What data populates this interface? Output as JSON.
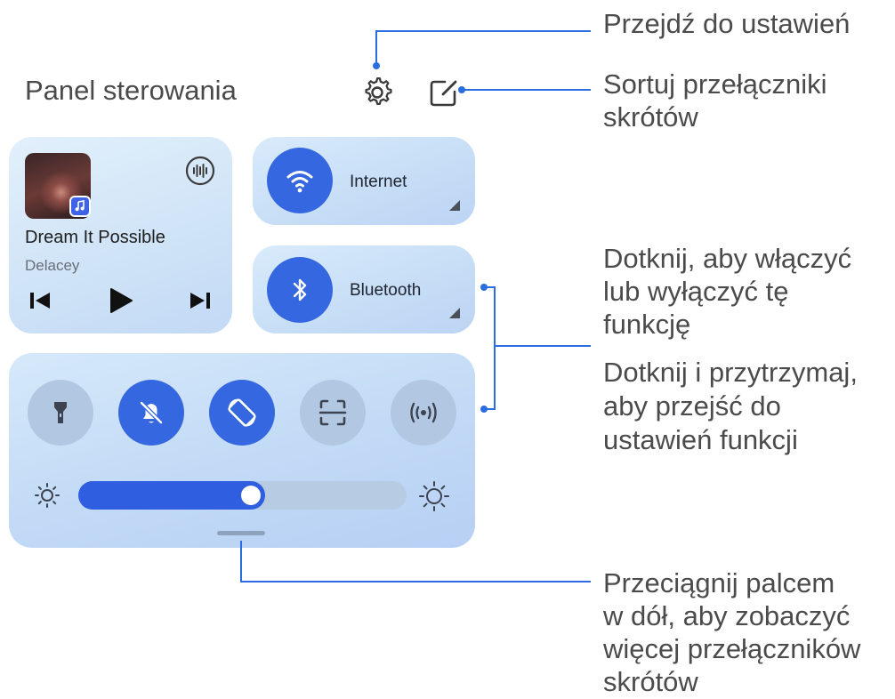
{
  "panel": {
    "title": "Panel sterowania"
  },
  "header_icons": {
    "settings": "gear-icon",
    "edit": "edit-shortcuts-icon"
  },
  "media": {
    "song_title": "Dream It Possible",
    "artist": "Delacey",
    "badge_icon": "music-app-icon",
    "wave_icon": "audio-wave-icon",
    "controls": [
      "previous-icon",
      "play-icon",
      "next-icon"
    ]
  },
  "tiles": {
    "internet": {
      "label": "Internet",
      "icon": "wifi-icon"
    },
    "bluetooth": {
      "label": "Bluetooth",
      "icon": "bluetooth-icon"
    }
  },
  "toggles": [
    {
      "icon": "flashlight-icon",
      "on": false
    },
    {
      "icon": "mute-bell-icon",
      "on": true
    },
    {
      "icon": "auto-rotate-icon",
      "on": true
    },
    {
      "icon": "scan-icon",
      "on": false
    },
    {
      "icon": "hotspot-icon",
      "on": false
    }
  ],
  "brightness": {
    "level": 0.57
  },
  "callouts": {
    "settings": "Przejdź do ustawień",
    "sort_line1": "Sortuj przełączniki",
    "sort_line2": "skrótów",
    "tap_line1": "Dotknij, aby włączyć",
    "tap_line2": "lub wyłączyć tę",
    "tap_line3": "funkcję",
    "hold_line1": "Dotknij i przytrzymaj,",
    "hold_line2": "aby przejść do",
    "hold_line3": "ustawień funkcji",
    "swipe_line1": "Przeciągnij palcem",
    "swipe_line2": "w dół, aby zobaczyć",
    "swipe_line3": "więcej przełączników",
    "swipe_line4": "skrótów"
  },
  "colors": {
    "accent": "#3567e0",
    "callout_line": "#2a6de0",
    "card": "#c7def6"
  }
}
